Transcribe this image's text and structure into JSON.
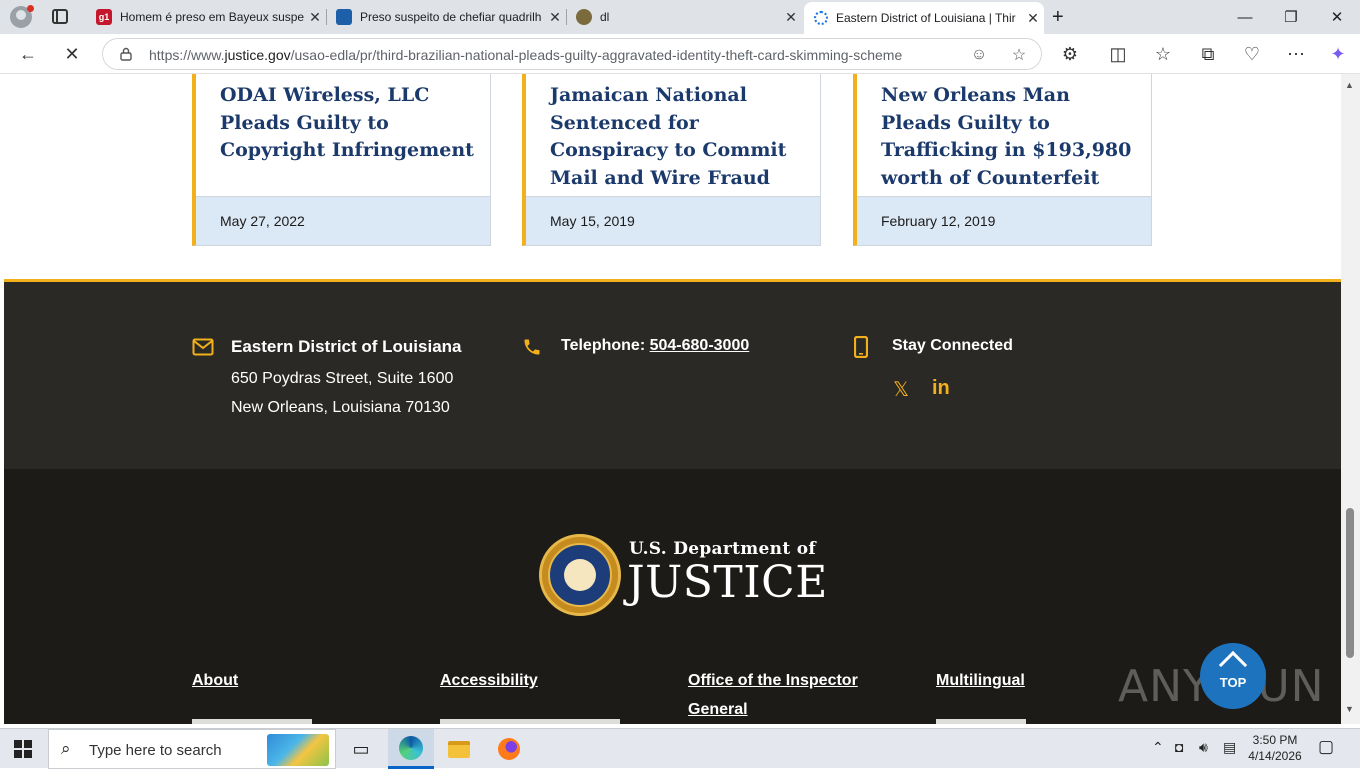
{
  "browser": {
    "tabs": [
      {
        "title": "Homem é preso em Bayeux suspe",
        "favicon": "g1",
        "active": false
      },
      {
        "title": "Preso suspeito de chefiar quadrilh",
        "favicon": "news",
        "active": false
      },
      {
        "title": "dl",
        "favicon": "web",
        "active": false
      },
      {
        "title": "Eastern District of Louisiana | Thir",
        "favicon": "loading",
        "active": true
      }
    ],
    "url_prefix": "https://www.",
    "url_domain": "justice.gov",
    "url_path": "/usao-edla/pr/third-brazilian-national-pleads-guilty-aggravated-identity-theft-card-skimming-scheme"
  },
  "cards": [
    {
      "title": "ODAI Wireless, LLC Pleads Guilty to Copyright Infringement",
      "date": "May 27, 2022"
    },
    {
      "title": "Jamaican National Sentenced for Conspiracy to Commit Mail and Wire Fraud",
      "date": "May 15, 2019"
    },
    {
      "title": "New Orleans Man Pleads Guilty to Trafficking in $193,980 worth of Counterfeit Goods",
      "date": "February 12, 2019"
    }
  ],
  "contact": {
    "office_name": "Eastern District of Louisiana",
    "address_line1": "650 Poydras Street, Suite 1600",
    "address_line2": "New Orleans, Louisiana 70130",
    "phone_label": "Telephone:",
    "phone_number": "504-680-3000",
    "stay_connected": "Stay Connected",
    "social": [
      "x-icon",
      "linkedin-icon"
    ]
  },
  "footer": {
    "logo_top": "U.S. Department of",
    "logo_main": "JUSTICE",
    "links": [
      {
        "label": "About"
      },
      {
        "label": "Accessibility"
      },
      {
        "label": "Office of the Inspector General"
      },
      {
        "label": "Multilingual"
      }
    ],
    "top_button": "TOP"
  },
  "watermark": "ANY RUN",
  "taskbar": {
    "search_placeholder": "Type here to search",
    "time": "3:50 PM",
    "date": "4/14/2026"
  },
  "colors": {
    "accent_gold": "#f2b01c",
    "title_navy": "#1b3a6b",
    "date_band": "#dbe8f5",
    "contact_bg": "#2b2925",
    "footer_bg": "#1c1b17"
  }
}
